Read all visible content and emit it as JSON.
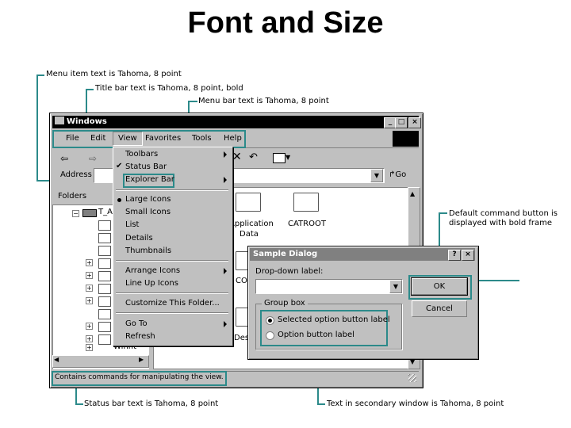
{
  "slide_title": "Font and Size",
  "callouts": {
    "menu_item": "Menu item text is Tahoma, 8 point",
    "title_bar": "Title bar text is Tahoma, 8 point, bold",
    "menu_bar": "Menu bar text is Tahoma, 8 point",
    "default_button_1": "Default command button is",
    "default_button_2": "displayed with bold frame",
    "status_bar": "Status bar text is Tahoma, 8 point",
    "secondary_window": "Text in secondary window is Tahoma, 8 point"
  },
  "window": {
    "title": "Windows",
    "menu": [
      "File",
      "Edit",
      "View",
      "Favorites",
      "Tools",
      "Help"
    ],
    "address_label": "Address",
    "address_value": "T_A",
    "go_label": "Go",
    "folders_label": "Folders",
    "status_text": "Contains commands for manipulating the view."
  },
  "view_menu": {
    "items_1": [
      "Toolbars",
      "Status Bar",
      "Explorer Bar"
    ],
    "items_2": [
      "Large Icons",
      "Small Icons",
      "List",
      "Details",
      "Thumbnails"
    ],
    "items_3": [
      "Arrange Icons",
      "Line Up Icons"
    ],
    "items_4": [
      "Customize This Folder..."
    ],
    "items_5": [
      "Go To",
      "Refresh"
    ]
  },
  "content": {
    "icon_1": "Application",
    "icon_1b": "Data",
    "icon_2": "CATROOT",
    "partial_1": "CO",
    "partial_2": "Des",
    "tree_partial": "Winnt"
  },
  "dialog": {
    "title": "Sample Dialog",
    "dropdown_label": "Drop-down label:",
    "ok": "OK",
    "cancel": "Cancel",
    "group_box": "Group box",
    "option_1": "Selected option button label",
    "option_2": "Option button label"
  }
}
